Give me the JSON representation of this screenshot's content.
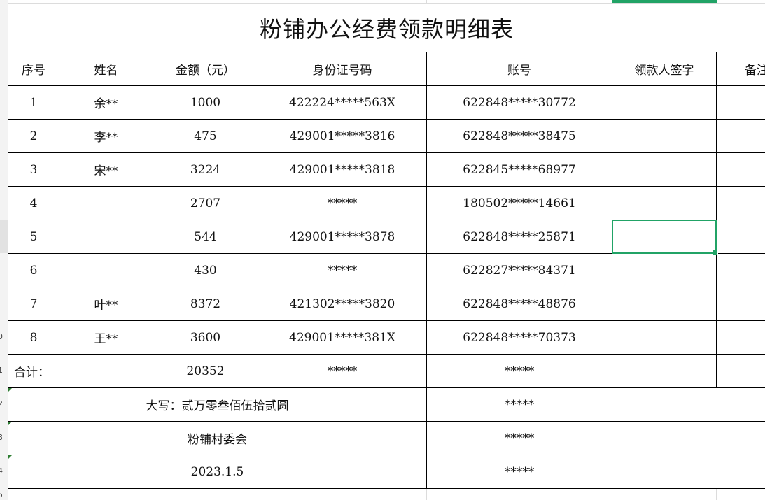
{
  "sheet": {
    "title": "粉铺办公经费领款明细表",
    "headers": [
      "序号",
      "姓名",
      "金额（元）",
      "身份证号码",
      "账号",
      "领款人签字",
      "备注"
    ],
    "rows": [
      {
        "no": "1",
        "name": "余**",
        "amount": "1000",
        "id": "422224*****563X",
        "account": "622848*****30772"
      },
      {
        "no": "2",
        "name": "李**",
        "amount": "475",
        "id": "429001*****3816",
        "account": "622848*****38475"
      },
      {
        "no": "3",
        "name": "宋**",
        "amount": "3224",
        "id": "429001*****3818",
        "account": "622845*****68977"
      },
      {
        "no": "4",
        "name": "",
        "amount": "2707",
        "id": "*****",
        "account": "180502*****14661"
      },
      {
        "no": "5",
        "name": "",
        "amount": "544",
        "id": "429001*****3878",
        "account": "622848*****25871"
      },
      {
        "no": "6",
        "name": "",
        "amount": "430",
        "id": "*****",
        "account": "622827*****84371"
      },
      {
        "no": "7",
        "name": "叶**",
        "amount": "8372",
        "id": "421302*****3820",
        "account": "622848*****48876"
      },
      {
        "no": "8",
        "name": "王**",
        "amount": "3600",
        "id": "429001*****381X",
        "account": "622848*****70373"
      }
    ],
    "total": {
      "label": "合计：",
      "amount": "20352",
      "id": "*****",
      "account": "*****"
    },
    "capital": {
      "text": "大写：贰万零叁佰伍拾贰圆",
      "account": "*****"
    },
    "committee": {
      "text": "粉铺村委会",
      "account": "*****"
    },
    "date": {
      "text": "2023.1.5",
      "account": "*****"
    }
  },
  "row_headers": [
    "0",
    "1",
    "2",
    "3",
    "4",
    "5"
  ],
  "colors": {
    "selection": "#21a366",
    "gridline": "#dcdcdc",
    "border": "#000000"
  }
}
